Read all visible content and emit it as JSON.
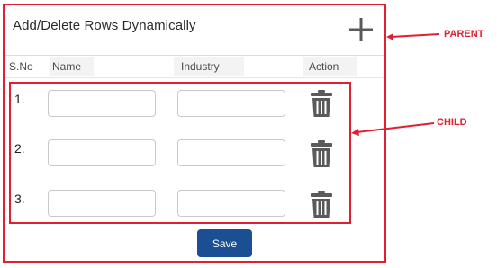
{
  "card": {
    "title": "Add/Delete Rows Dynamically",
    "add_icon": "plus-icon"
  },
  "table": {
    "headers": {
      "sno": "S.No",
      "name": "Name",
      "industry": "Industry",
      "action": "Action"
    },
    "rows": [
      {
        "number": "1.",
        "name_value": "",
        "industry_value": "",
        "delete_icon": "trash-icon"
      },
      {
        "number": "2.",
        "name_value": "",
        "industry_value": "",
        "delete_icon": "trash-icon"
      },
      {
        "number": "3.",
        "name_value": "",
        "industry_value": "",
        "delete_icon": "trash-icon"
      }
    ]
  },
  "save_button": {
    "label": "Save"
  },
  "annotations": {
    "parent": "PARENT",
    "child": "CHILD"
  },
  "colors": {
    "annotation": "#e02030",
    "save_button": "#1b4f93",
    "icon": "#5a5a5a"
  }
}
